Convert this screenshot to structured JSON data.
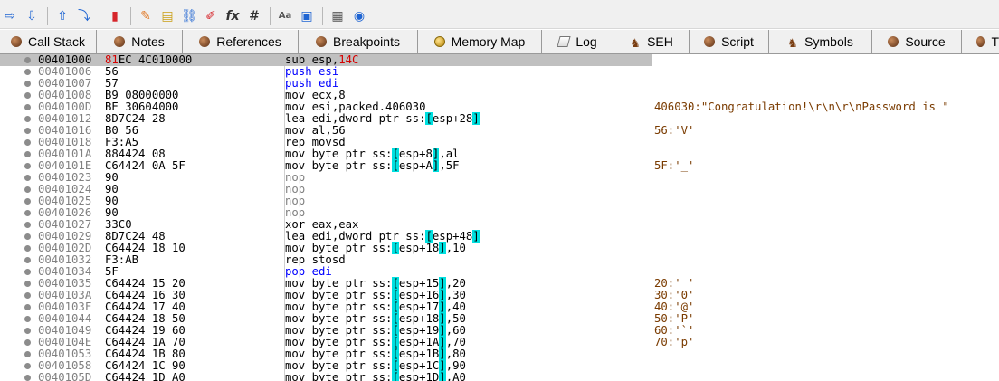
{
  "toolbar": {
    "buttons": [
      {
        "icon": "run-arrow-icon",
        "glyph": "⇨"
      },
      {
        "icon": "step-into-down-arrow-icon",
        "glyph": "⇩"
      },
      {
        "icon": "step-up-arrow-icon",
        "glyph": "⇧"
      },
      {
        "icon": "step-over-icon",
        "glyph": "⤵"
      },
      {
        "icon": "trace-stop-icon",
        "glyph": "▮"
      },
      {
        "icon": "pencil-icon",
        "glyph": "✎"
      },
      {
        "icon": "comment-icon",
        "glyph": "▤"
      },
      {
        "icon": "link-icon",
        "glyph": "⛓"
      },
      {
        "icon": "red-pencil-icon",
        "glyph": "✐"
      },
      {
        "icon": "function-icon",
        "glyph": "fx"
      },
      {
        "icon": "hash-icon",
        "glyph": "#"
      },
      {
        "icon": "font-size-icon",
        "glyph": "Aa"
      },
      {
        "icon": "module-icon",
        "glyph": "▣"
      },
      {
        "icon": "calculator-icon",
        "glyph": "▦"
      },
      {
        "icon": "globe-icon",
        "glyph": "◉"
      }
    ]
  },
  "tabs": [
    {
      "label": "Call Stack",
      "icon": "call-stack-icon"
    },
    {
      "label": "Notes",
      "icon": "notes-icon"
    },
    {
      "label": "References",
      "icon": "references-icon"
    },
    {
      "label": "Breakpoints",
      "icon": "breakpoints-icon"
    },
    {
      "label": "Memory Map",
      "icon": "memory-map-icon"
    },
    {
      "label": "Log",
      "icon": "log-icon"
    },
    {
      "label": "SEH",
      "icon": "seh-icon"
    },
    {
      "label": "Script",
      "icon": "script-icon"
    },
    {
      "label": "Symbols",
      "icon": "symbols-icon"
    },
    {
      "label": "Source",
      "icon": "source-icon"
    },
    {
      "label": "T",
      "icon": "threads-icon"
    }
  ],
  "disassembly": {
    "selected_address": "00401000",
    "rows": [
      {
        "addr": "00401000",
        "bytes": "81EC 4C010000",
        "instr": [
          {
            "t": "sub esp,",
            "c": "n"
          },
          {
            "t": "14C",
            "c": "r"
          }
        ],
        "comment": ""
      },
      {
        "addr": "00401006",
        "bytes": "56",
        "instr": [
          {
            "t": "push esi",
            "c": "s"
          }
        ],
        "comment": ""
      },
      {
        "addr": "00401007",
        "bytes": "57",
        "instr": [
          {
            "t": "push edi",
            "c": "s"
          }
        ],
        "comment": ""
      },
      {
        "addr": "00401008",
        "bytes": "B9 08000000",
        "instr": [
          {
            "t": "mov ecx,8",
            "c": "n"
          }
        ],
        "comment": ""
      },
      {
        "addr": "0040100D",
        "bytes": "BE 30604000",
        "instr": [
          {
            "t": "mov esi,packed.406030",
            "c": "n"
          }
        ],
        "comment": "406030:\"Congratulation!\\r\\n\\r\\nPassword is \""
      },
      {
        "addr": "00401012",
        "bytes": "8D7C24 28",
        "instr": [
          {
            "t": "lea edi,dword ptr ss:",
            "c": "n"
          },
          {
            "t": "[",
            "c": "b"
          },
          {
            "t": "esp+28",
            "c": "n"
          },
          {
            "t": "]",
            "c": "b"
          }
        ],
        "comment": ""
      },
      {
        "addr": "00401016",
        "bytes": "B0 56",
        "instr": [
          {
            "t": "mov al,56",
            "c": "n"
          }
        ],
        "comment": "56:'V'"
      },
      {
        "addr": "00401018",
        "bytes": "F3:A5",
        "instr": [
          {
            "t": "rep movsd",
            "c": "n"
          }
        ],
        "comment": ""
      },
      {
        "addr": "0040101A",
        "bytes": "884424 08",
        "instr": [
          {
            "t": "mov byte ptr ss:",
            "c": "n"
          },
          {
            "t": "[",
            "c": "b"
          },
          {
            "t": "esp+8",
            "c": "n"
          },
          {
            "t": "]",
            "c": "b"
          },
          {
            "t": ",al",
            "c": "n"
          }
        ],
        "comment": ""
      },
      {
        "addr": "0040101E",
        "bytes": "C64424 0A 5F",
        "instr": [
          {
            "t": "mov byte ptr ss:",
            "c": "n"
          },
          {
            "t": "[",
            "c": "b"
          },
          {
            "t": "esp+A",
            "c": "n"
          },
          {
            "t": "]",
            "c": "b"
          },
          {
            "t": ",5F",
            "c": "n"
          }
        ],
        "comment": "5F:'_'"
      },
      {
        "addr": "00401023",
        "bytes": "90",
        "instr": [
          {
            "t": "nop",
            "c": "g"
          }
        ],
        "comment": ""
      },
      {
        "addr": "00401024",
        "bytes": "90",
        "instr": [
          {
            "t": "nop",
            "c": "g"
          }
        ],
        "comment": ""
      },
      {
        "addr": "00401025",
        "bytes": "90",
        "instr": [
          {
            "t": "nop",
            "c": "g"
          }
        ],
        "comment": ""
      },
      {
        "addr": "00401026",
        "bytes": "90",
        "instr": [
          {
            "t": "nop",
            "c": "g"
          }
        ],
        "comment": ""
      },
      {
        "addr": "00401027",
        "bytes": "33C0",
        "instr": [
          {
            "t": "xor eax,eax",
            "c": "n"
          }
        ],
        "comment": ""
      },
      {
        "addr": "00401029",
        "bytes": "8D7C24 48",
        "instr": [
          {
            "t": "lea edi,dword ptr ss:",
            "c": "n"
          },
          {
            "t": "[",
            "c": "b"
          },
          {
            "t": "esp+48",
            "c": "n"
          },
          {
            "t": "]",
            "c": "b"
          }
        ],
        "comment": ""
      },
      {
        "addr": "0040102D",
        "bytes": "C64424 18 10",
        "instr": [
          {
            "t": "mov byte ptr ss:",
            "c": "n"
          },
          {
            "t": "[",
            "c": "b"
          },
          {
            "t": "esp+18",
            "c": "n"
          },
          {
            "t": "]",
            "c": "b"
          },
          {
            "t": ",10",
            "c": "n"
          }
        ],
        "comment": ""
      },
      {
        "addr": "00401032",
        "bytes": "F3:AB",
        "instr": [
          {
            "t": "rep stosd",
            "c": "n"
          }
        ],
        "comment": ""
      },
      {
        "addr": "00401034",
        "bytes": "5F",
        "instr": [
          {
            "t": "pop edi",
            "c": "s"
          }
        ],
        "comment": ""
      },
      {
        "addr": "00401035",
        "bytes": "C64424 15 20",
        "instr": [
          {
            "t": "mov byte ptr ss:",
            "c": "n"
          },
          {
            "t": "[",
            "c": "b"
          },
          {
            "t": "esp+15",
            "c": "n"
          },
          {
            "t": "]",
            "c": "b"
          },
          {
            "t": ",20",
            "c": "n"
          }
        ],
        "comment": "20:' '"
      },
      {
        "addr": "0040103A",
        "bytes": "C64424 16 30",
        "instr": [
          {
            "t": "mov byte ptr ss:",
            "c": "n"
          },
          {
            "t": "[",
            "c": "b"
          },
          {
            "t": "esp+16",
            "c": "n"
          },
          {
            "t": "]",
            "c": "b"
          },
          {
            "t": ",30",
            "c": "n"
          }
        ],
        "comment": "30:'0'"
      },
      {
        "addr": "0040103F",
        "bytes": "C64424 17 40",
        "instr": [
          {
            "t": "mov byte ptr ss:",
            "c": "n"
          },
          {
            "t": "[",
            "c": "b"
          },
          {
            "t": "esp+17",
            "c": "n"
          },
          {
            "t": "]",
            "c": "b"
          },
          {
            "t": ",40",
            "c": "n"
          }
        ],
        "comment": "40:'@'"
      },
      {
        "addr": "00401044",
        "bytes": "C64424 18 50",
        "instr": [
          {
            "t": "mov byte ptr ss:",
            "c": "n"
          },
          {
            "t": "[",
            "c": "b"
          },
          {
            "t": "esp+18",
            "c": "n"
          },
          {
            "t": "]",
            "c": "b"
          },
          {
            "t": ",50",
            "c": "n"
          }
        ],
        "comment": "50:'P'"
      },
      {
        "addr": "00401049",
        "bytes": "C64424 19 60",
        "instr": [
          {
            "t": "mov byte ptr ss:",
            "c": "n"
          },
          {
            "t": "[",
            "c": "b"
          },
          {
            "t": "esp+19",
            "c": "n"
          },
          {
            "t": "]",
            "c": "b"
          },
          {
            "t": ",60",
            "c": "n"
          }
        ],
        "comment": "60:'`'"
      },
      {
        "addr": "0040104E",
        "bytes": "C64424 1A 70",
        "instr": [
          {
            "t": "mov byte ptr ss:",
            "c": "n"
          },
          {
            "t": "[",
            "c": "b"
          },
          {
            "t": "esp+1A",
            "c": "n"
          },
          {
            "t": "]",
            "c": "b"
          },
          {
            "t": ",70",
            "c": "n"
          }
        ],
        "comment": "70:'p'"
      },
      {
        "addr": "00401053",
        "bytes": "C64424 1B 80",
        "instr": [
          {
            "t": "mov byte ptr ss:",
            "c": "n"
          },
          {
            "t": "[",
            "c": "b"
          },
          {
            "t": "esp+1B",
            "c": "n"
          },
          {
            "t": "]",
            "c": "b"
          },
          {
            "t": ",80",
            "c": "n"
          }
        ],
        "comment": ""
      },
      {
        "addr": "00401058",
        "bytes": "C64424 1C 90",
        "instr": [
          {
            "t": "mov byte ptr ss:",
            "c": "n"
          },
          {
            "t": "[",
            "c": "b"
          },
          {
            "t": "esp+1C",
            "c": "n"
          },
          {
            "t": "]",
            "c": "b"
          },
          {
            "t": ",90",
            "c": "n"
          }
        ],
        "comment": ""
      },
      {
        "addr": "0040105D",
        "bytes": "C64424 1D A0",
        "instr": [
          {
            "t": "mov byte ptr ss:",
            "c": "n"
          },
          {
            "t": "[",
            "c": "b"
          },
          {
            "t": "esp+1D",
            "c": "n"
          },
          {
            "t": "]",
            "c": "b"
          },
          {
            "t": ",A0",
            "c": "n"
          }
        ],
        "comment": ""
      }
    ]
  },
  "colors": {
    "selection": "#c0c0c0",
    "bracket_highlight": "#00e0e0",
    "stack_op": "#0000ff",
    "nop": "#808080",
    "immediate_highlight": "#d40000",
    "comment": "#7a3b00"
  }
}
